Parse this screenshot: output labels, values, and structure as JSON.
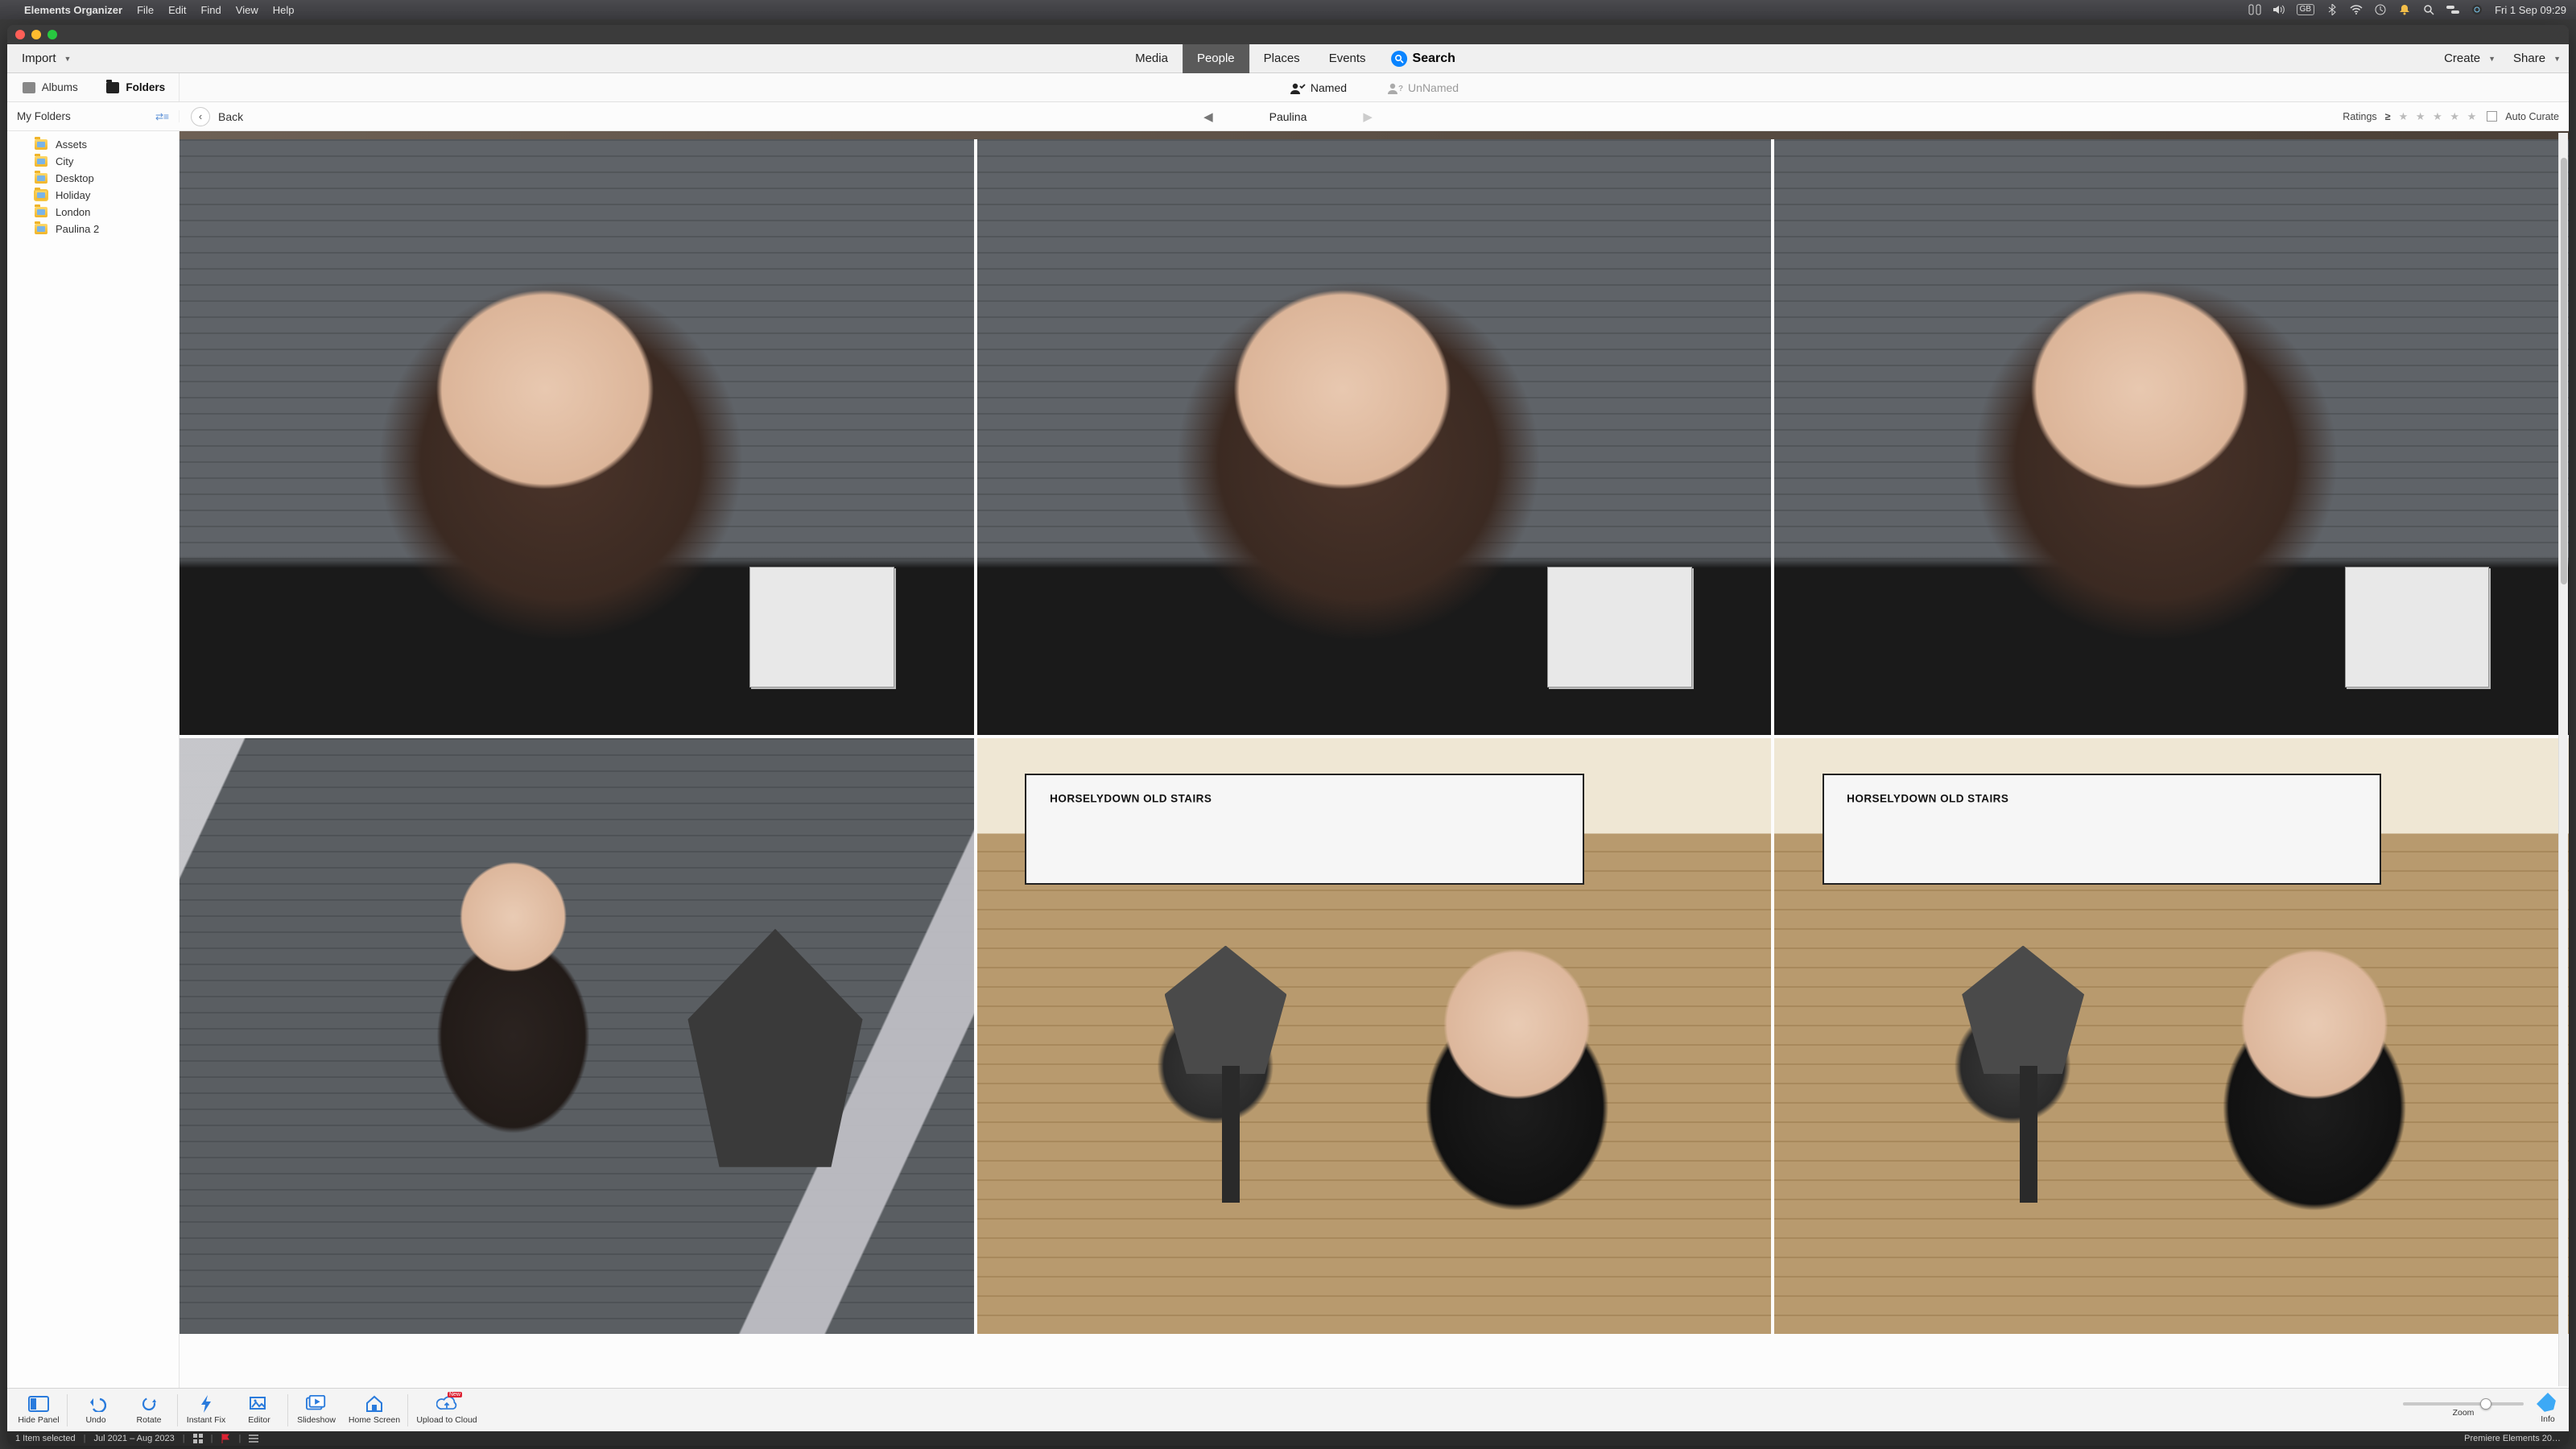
{
  "menubar": {
    "app": "Elements Organizer",
    "items": [
      "File",
      "Edit",
      "Find",
      "View",
      "Help"
    ],
    "kb": "GB",
    "datetime": "Fri 1 Sep  09:29"
  },
  "toolbar": {
    "import": "Import",
    "tabs": [
      "Media",
      "People",
      "Places",
      "Events"
    ],
    "active_tab": "People",
    "search": "Search",
    "create": "Create",
    "share": "Share"
  },
  "subbar": {
    "albums": "Albums",
    "folders": "Folders",
    "named": "Named",
    "unnamed": "UnNamed"
  },
  "sidebar": {
    "header": "My Folders",
    "items": [
      "Assets",
      "City",
      "Desktop",
      "Holiday",
      "London",
      "Paulina 2"
    ]
  },
  "nav": {
    "back": "Back",
    "person": "Paulina",
    "ratings_label": "Ratings",
    "auto_curate": "Auto Curate"
  },
  "grid": {
    "sign_text": "HORSELYDOWN OLD STAIRS"
  },
  "bottom": {
    "hide_panel": "Hide Panel",
    "undo": "Undo",
    "rotate": "Rotate",
    "instant_fix": "Instant Fix",
    "editor": "Editor",
    "slideshow": "Slideshow",
    "home_screen": "Home Screen",
    "upload": "Upload to Cloud",
    "zoom": "Zoom",
    "info": "Info"
  },
  "status": {
    "selection": "1 Item selected",
    "daterange": "Jul 2021 – Aug 2023",
    "app_right": "Premiere Elements 20…"
  }
}
